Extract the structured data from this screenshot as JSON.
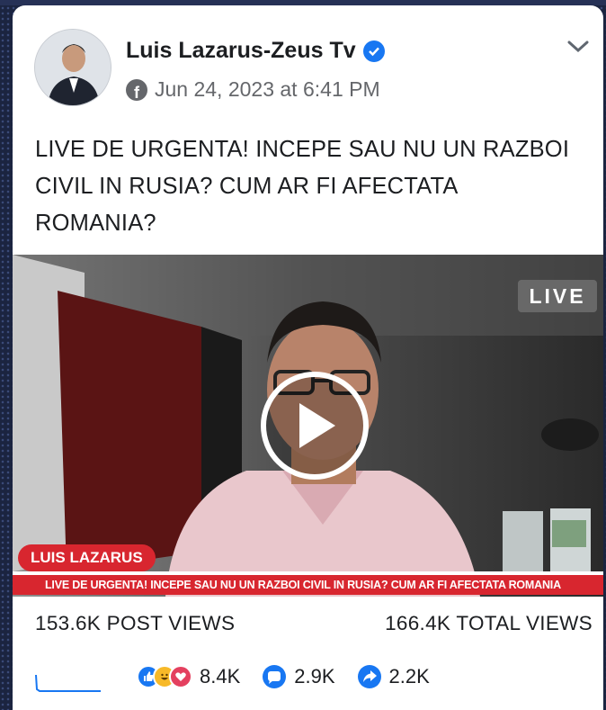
{
  "post": {
    "author": "Luis Lazarus-Zeus Tv",
    "verified": true,
    "platform_icon": "facebook-icon",
    "timestamp": "Jun 24, 2023 at 6:41 PM",
    "text": "LIVE DE URGENTA! INCEPE SAU NU UN RAZBOI CIVIL IN RUSIA? CUM AR FI AFECTATA ROMANIA?"
  },
  "video": {
    "live_label": "LIVE",
    "name_tag": "LUIS LAZARUS",
    "ticker": "LIVE DE URGENTA! INCEPE SAU NU UN RAZBOI CIVIL IN RUSIA? CUM AR FI AFECTATA ROMANIA"
  },
  "views": {
    "post_views": "153.6K POST VIEWS",
    "total_views": "166.4K TOTAL VIEWS"
  },
  "stats": {
    "reactions": "8.4K",
    "comments": "2.9K",
    "shares": "2.2K"
  },
  "colors": {
    "accent_blue": "#1877f2",
    "news_red": "#d8262f"
  }
}
